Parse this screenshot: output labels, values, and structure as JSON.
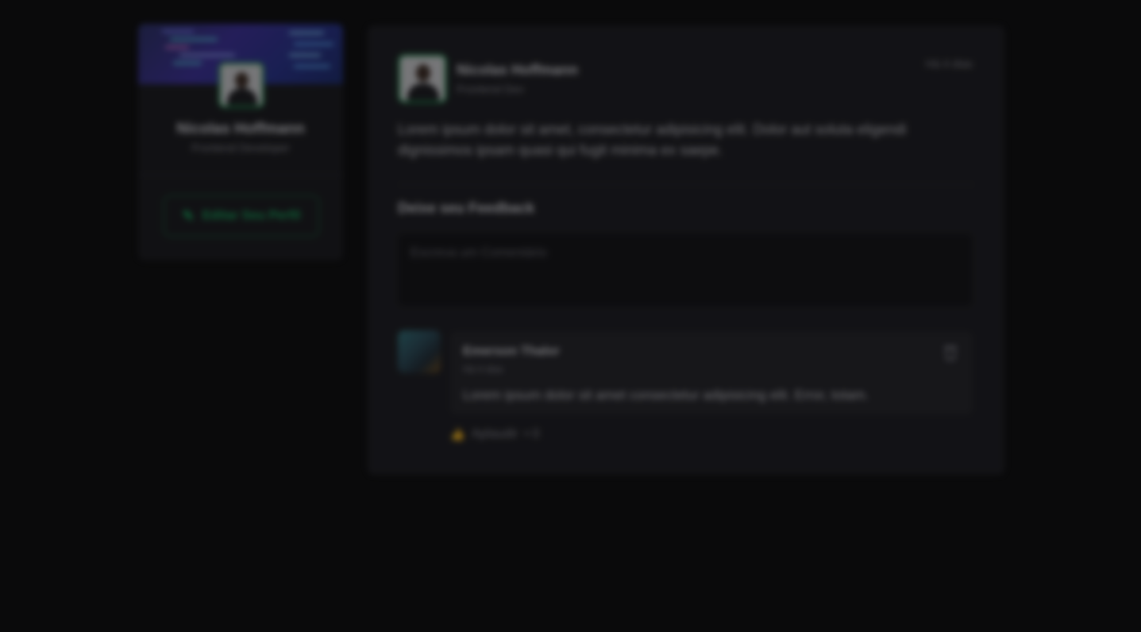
{
  "sidebar": {
    "name": "Nicolas Hoffmann",
    "role": "Frontend Developer",
    "edit_label": "Editar Seu Perfil"
  },
  "post": {
    "author_name": "Nicolas Hoffmann",
    "author_role": "Frontend Dev",
    "time": "Há 4 dias",
    "content": "Lorem ipsum dolor sit amet, consectetur adipisicing elit. Dolor aut soluta eligendi dignissimos ipsam quasi qui fugit minima ex saepe.",
    "feedback_title": "Deixe seu Feedback",
    "comment_placeholder": "Escreva um Comentário"
  },
  "comment": {
    "author_name": "Emerson Thalor",
    "time": "Há 4 dias",
    "text": "Lorem ipsum dolor sit amet consectetur adipisicing elit. Error, totam.",
    "applause_label": "Aplaudir",
    "applause_count": "• 0"
  },
  "colors": {
    "accent_green": "#13a85a",
    "card": "#1a1a1f",
    "background": "#0a0a0b"
  }
}
